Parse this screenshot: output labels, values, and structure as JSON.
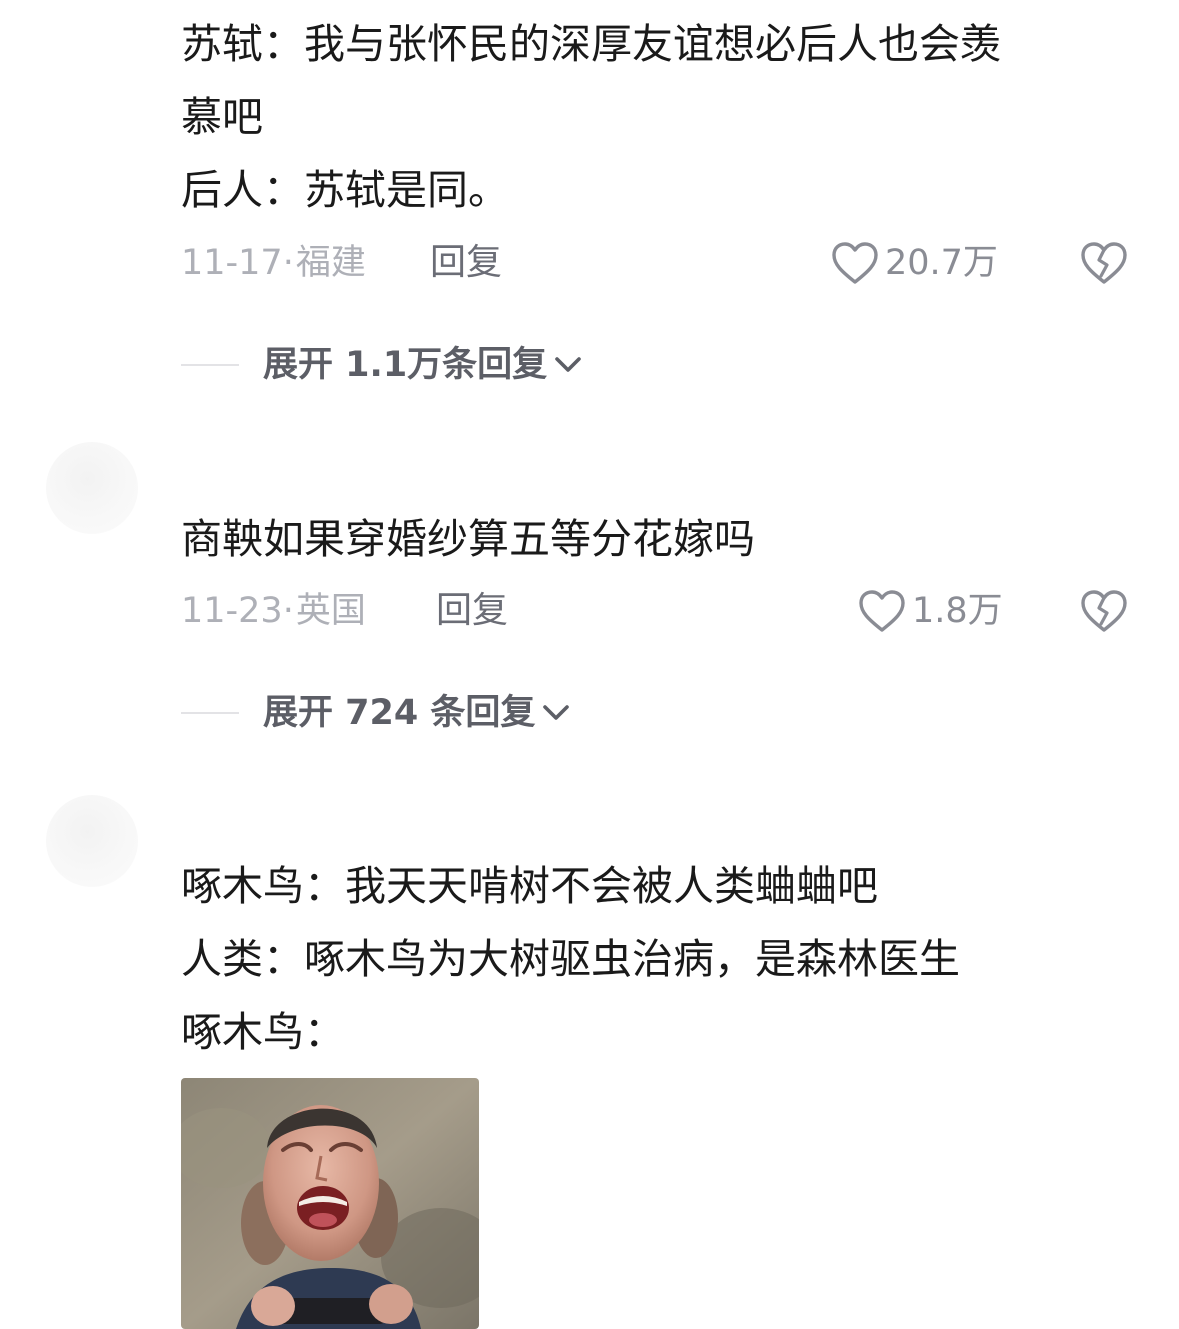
{
  "comments": [
    {
      "text": "苏轼：我与张怀民的深厚友谊想必后人也会羡\n慕吧\n后人：苏轼是同。",
      "date": "11-17",
      "location": "福建",
      "reply_label": "回复",
      "likes": "20.7万",
      "expand_label": "展开 1.1万条回复"
    },
    {
      "text": "商鞅如果穿婚纱算五等分花嫁吗",
      "date": "11-23",
      "location": "英国",
      "reply_label": "回复",
      "likes": "1.8万",
      "expand_label": "展开 724 条回复"
    },
    {
      "text": "啄木鸟：我天天啃树不会被人类蛐蛐吧\n人类：啄木鸟为大树驱虫治病，是森林医生\n啄木鸟：",
      "has_image": true
    }
  ],
  "colors": {
    "text": "#1a1a1a",
    "meta": "#aeb0b7",
    "reply": "#6b6d76",
    "icon": "#8a8c94",
    "expand": "#5c5e66"
  },
  "icons": [
    "heart-outline-icon",
    "broken-heart-icon",
    "chevron-down-icon"
  ]
}
